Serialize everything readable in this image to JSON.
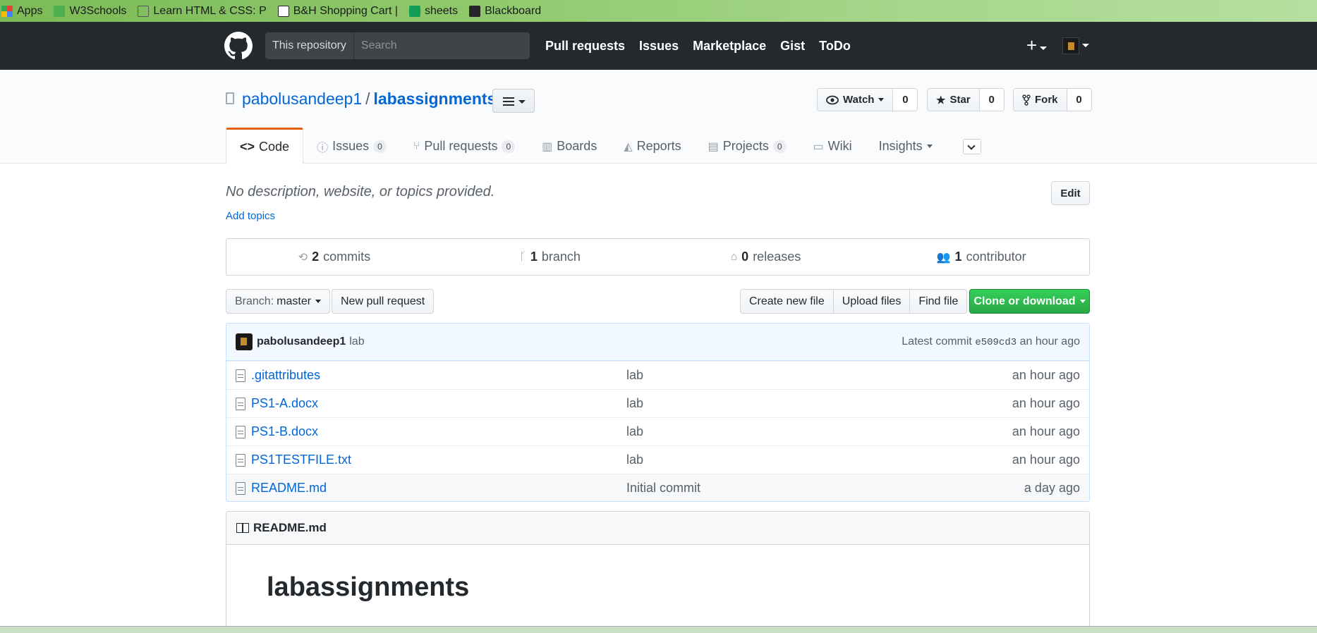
{
  "bookmarks": [
    {
      "label": "Apps",
      "icon": "apps-grid-icon",
      "color": "#e94235"
    },
    {
      "label": "W3Schools",
      "icon": "w3schools-icon",
      "color": "#4caf50"
    },
    {
      "label": "Learn HTML & CSS: P",
      "icon": "codecademy-icon",
      "color": "#555555"
    },
    {
      "label": "B&H Shopping Cart |",
      "icon": "bh-icon",
      "color": "#222222"
    },
    {
      "label": "sheets",
      "icon": "sheets-icon",
      "color": "#0f9d58"
    },
    {
      "label": "Blackboard",
      "icon": "blackboard-icon",
      "color": "#262626"
    }
  ],
  "header": {
    "search_scope": "This repository",
    "search_placeholder": "Search",
    "nav": [
      "Pull requests",
      "Issues",
      "Marketplace",
      "Gist",
      "ToDo"
    ],
    "plus": "+"
  },
  "repo": {
    "owner": "pabolusandeep1",
    "separator": "/",
    "name": "labassignments",
    "watch": {
      "label": "Watch",
      "count": "0"
    },
    "star": {
      "label": "Star",
      "count": "0"
    },
    "fork": {
      "label": "Fork",
      "count": "0"
    }
  },
  "tabs": [
    {
      "label": "Code",
      "counter": ""
    },
    {
      "label": "Issues",
      "counter": "0"
    },
    {
      "label": "Pull requests",
      "counter": "0"
    },
    {
      "label": "Boards",
      "counter": ""
    },
    {
      "label": "Reports",
      "counter": ""
    },
    {
      "label": "Projects",
      "counter": "0"
    },
    {
      "label": "Wiki",
      "counter": ""
    },
    {
      "label": "Insights",
      "counter": ""
    }
  ],
  "description": "No description, website, or topics provided.",
  "add_topics": "Add topics",
  "edit_label": "Edit",
  "numbers": {
    "commits": {
      "count": "2",
      "label": "commits"
    },
    "branch": {
      "count": "1",
      "label": "branch"
    },
    "releases": {
      "count": "0",
      "label": "releases"
    },
    "contributor": {
      "count": "1",
      "label": "contributor"
    }
  },
  "toolbar": {
    "branch_prefix": "Branch:",
    "branch_name": "master",
    "new_pr": "New pull request",
    "create_file": "Create new file",
    "upload_files": "Upload files",
    "find_file": "Find file",
    "clone": "Clone or download"
  },
  "latest_commit": {
    "author": "pabolusandeep1",
    "message": "lab",
    "prefix": "Latest commit",
    "sha": "e509cd3",
    "age": "an hour ago"
  },
  "files": [
    {
      "name": ".gitattributes",
      "message": "lab",
      "age": "an hour ago"
    },
    {
      "name": "PS1-A.docx",
      "message": "lab",
      "age": "an hour ago"
    },
    {
      "name": "PS1-B.docx",
      "message": "lab",
      "age": "an hour ago"
    },
    {
      "name": "PS1TESTFILE.txt",
      "message": "lab",
      "age": "an hour ago"
    },
    {
      "name": "README.md",
      "message": "Initial commit",
      "age": "a day ago"
    }
  ],
  "readme": {
    "filename": "README.md",
    "heading": "labassignments"
  }
}
